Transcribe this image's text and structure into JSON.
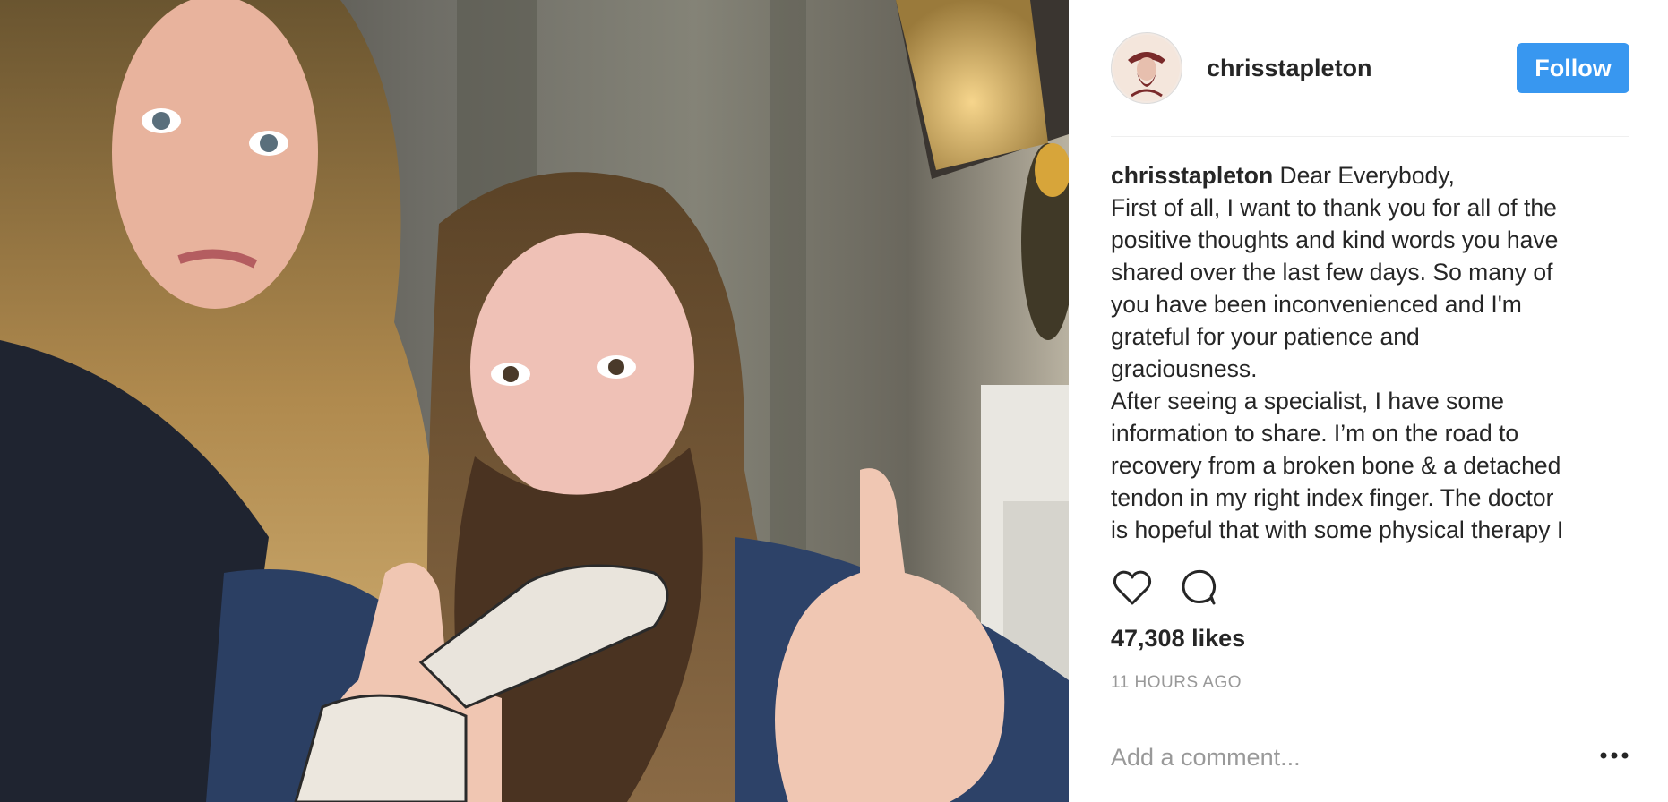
{
  "post": {
    "photo": {
      "description_icon": "selfie-photo"
    },
    "header": {
      "username": "chrisstapleton",
      "follow_label": "Follow",
      "avatar_icon": "avatar-illustration"
    },
    "caption": {
      "username": "chrisstapleton",
      "lines": [
        "Dear Everybody,",
        "First of all, I want to thank you for all of the",
        "positive thoughts and kind words you have",
        "shared over the last few days. So many of",
        "you have been inconvenienced and I'm",
        "grateful for your patience and",
        "graciousness.",
        "After seeing a specialist, I have some",
        "information to share. I’m on the road to",
        "recovery from a broken bone & a detached",
        "tendon in my right index finger. The doctor",
        "is hopeful that with some physical therapy I"
      ]
    },
    "actions": {
      "like_icon": "heart-icon",
      "comment_icon": "comment-icon"
    },
    "likes_text": "47,308 likes",
    "timestamp": "11 HOURS AGO",
    "comment": {
      "placeholder": "Add a comment...",
      "more_icon": "more-options-icon"
    },
    "colors": {
      "follow_button": "#3897f0",
      "divider": "#efefef",
      "muted_text": "#999999",
      "text": "#262626"
    }
  }
}
